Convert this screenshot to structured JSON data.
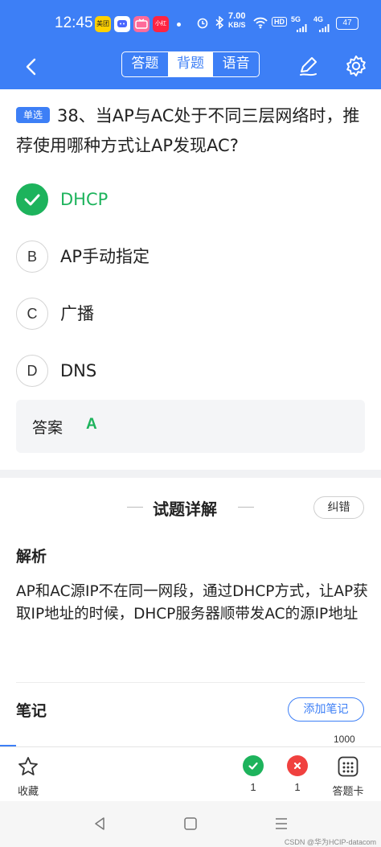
{
  "status_bar": {
    "time": "12:45",
    "app_badges": [
      "美团",
      "",
      "",
      "小红书"
    ],
    "net_speed_value": "7.00",
    "net_speed_unit": "KB/S",
    "hd": "HD",
    "sig1": "5G",
    "sig2": "4G",
    "battery": "47"
  },
  "header": {
    "tabs": [
      "答题",
      "背题",
      "语音"
    ],
    "active_tab": "背题"
  },
  "question": {
    "type": "单选",
    "text": "38、当AP与AC处于不同三层网络时，推荐使用哪种方式让AP发现AC?",
    "options": [
      {
        "letter": "A",
        "text": "DHCP",
        "correct": true
      },
      {
        "letter": "B",
        "text": "AP手动指定",
        "correct": false
      },
      {
        "letter": "C",
        "text": "广播",
        "correct": false
      },
      {
        "letter": "D",
        "text": "DNS",
        "correct": false
      }
    ],
    "answer_label": "答案",
    "answer_value": "A"
  },
  "detail": {
    "title": "试题详解",
    "report_label": "纠错",
    "analysis_label": "解析",
    "analysis_text": "AP和AC源IP不在同一网段，通过DHCP方式，让AP获取IP地址的时候，DHCP服务器顺带发AC的源IP地址"
  },
  "notes": {
    "label": "笔记",
    "add_label": "添加笔记",
    "char_limit": "1000"
  },
  "bottom": {
    "favorite_label": "收藏",
    "correct_count": "1",
    "wrong_count": "1",
    "card_label": "答题卡"
  },
  "watermark": "CSDN @华为HCIP-datacom",
  "colors": {
    "primary": "#3d7ff6",
    "correct": "#1db35c",
    "wrong": "#f0413f"
  }
}
